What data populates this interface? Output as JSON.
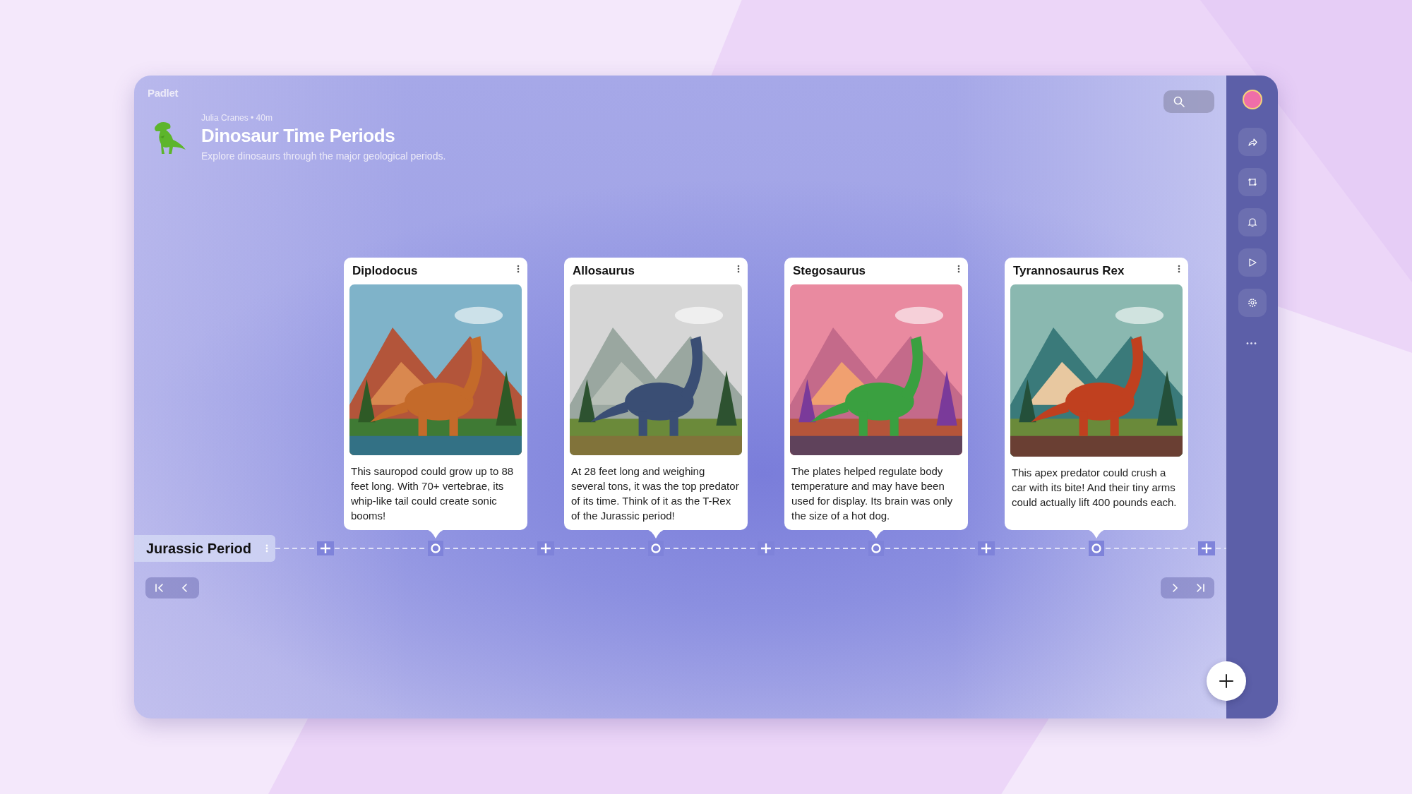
{
  "brand": "Padlet",
  "header": {
    "byline": "Julia Cranes • 40m",
    "title": "Dinosaur Time Periods",
    "description": "Explore dinosaurs through the major geological periods."
  },
  "section": {
    "title": "Jurassic Period",
    "posts": [
      {
        "title": "Diplodocus",
        "text": "This sauropod could grow up to 88 feet long. With 70+ vertebrae, its whip-like tail could create sonic booms!",
        "kind": "picture"
      },
      {
        "title": "Allosaurus",
        "text": "At 28 feet long and weighing several tons, it was the top predator of its time. Think of it as the T-Rex of the Jurassic period!",
        "kind": "picture"
      },
      {
        "title": "Stegosaurus",
        "text": "The plates helped regulate body temperature and may have been used for display. Its brain was only the size of a hot dog.",
        "kind": "picture"
      },
      {
        "title": "Tyrannosaurus Rex",
        "text": "This apex predator could crush a car with its bite! And their tiny arms could actually lift 400 pounds each.",
        "kind": "picture"
      }
    ]
  },
  "sidebar": {
    "more": "•••"
  }
}
